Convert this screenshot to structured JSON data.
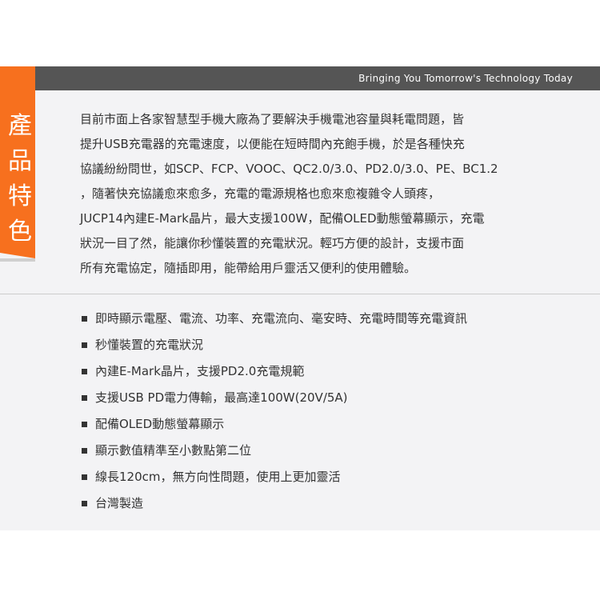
{
  "header": {
    "tagline": "Bringing You Tomorrow's Technology Today"
  },
  "section": {
    "label_chars": [
      "產",
      "品",
      "特",
      "色"
    ]
  },
  "intro": {
    "lines": [
      "目前市面上各家智慧型手機大廠為了要解決手機電池容量與耗電問題，皆",
      "提升USB充電器的充電速度，以便能在短時間內充飽手機，於是各種快充",
      "協議紛紛問世，如SCP、FCP、VOOC、QC2.0/3.0、PD2.0/3.0、PE、BC1.2",
      "，隨著快充協議愈來愈多，充電的電源規格也愈來愈複雜令人頭疼，",
      "JUCP14內建E-Mark晶片，最大支援100W，配備OLED動態螢幕顯示，充電",
      "狀況一目了然，能讓你秒懂裝置的充電狀況。輕巧方便的設計，支援市面",
      "所有充電協定，隨插即用，能帶給用戶靈活又便利的使用體驗。"
    ]
  },
  "features": [
    "即時顯示電壓、電流、功率、充電流向、毫安時、充電時間等充電資訊",
    "秒懂裝置的充電狀況",
    "內建E-Mark晶片，支援PD2.0充電規範",
    "支援USB PD電力傳輸，最高達100W(20V/5A)",
    "配備OLED動態螢幕顯示",
    "顯示數值精準至小數點第二位",
    "線長120cm，無方向性問題，使用上更加靈活",
    "台灣製造"
  ],
  "colors": {
    "accent": "#f7701e",
    "header_bar": "#555555",
    "panel_bg": "#f3f3f5",
    "text": "#333333"
  }
}
